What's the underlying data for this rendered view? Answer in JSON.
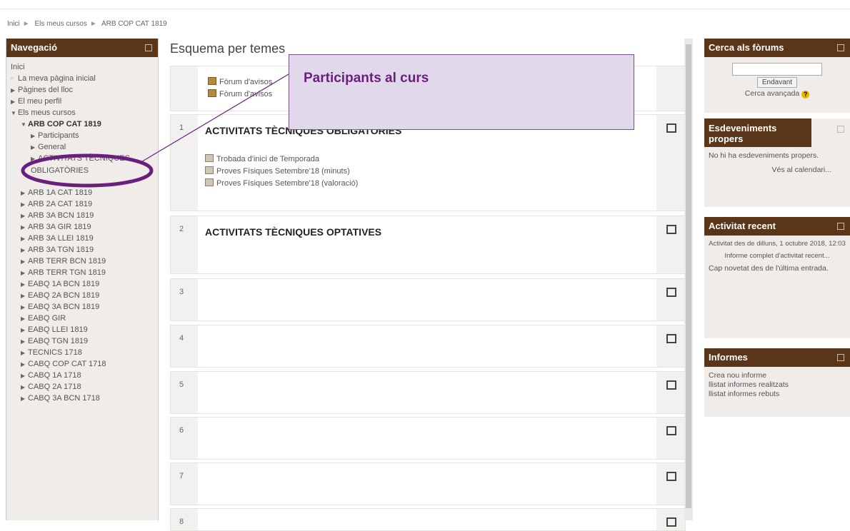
{
  "breadcrumb": [
    "Inici",
    "Els meus cursos",
    "ARB COP CAT 1819"
  ],
  "nav": {
    "title": "Navegació",
    "items": [
      {
        "label": "Inici"
      },
      {
        "label": "La meva pàgina inicial"
      },
      {
        "label": "Pàgines del lloc"
      },
      {
        "label": "El meu perfil"
      },
      {
        "label": "Els meus cursos"
      },
      {
        "label": "ARB COP CAT 1819"
      },
      {
        "label": "Participants"
      },
      {
        "label": "General"
      },
      {
        "label": "ACTIVITATS TÈCNIQUES OBLIGATÒRIES"
      },
      {
        "label": "ARB 1A CAT 1819"
      },
      {
        "label": "ARB 2A CAT 1819"
      },
      {
        "label": "ARB 3A BCN 1819"
      },
      {
        "label": "ARB 3A GIR 1819"
      },
      {
        "label": "ARB 3A LLEI 1819"
      },
      {
        "label": "ARB 3A TGN 1819"
      },
      {
        "label": "ARB TERR BCN 1819"
      },
      {
        "label": "ARB TERR TGN 1819"
      },
      {
        "label": "EABQ 1A BCN 1819"
      },
      {
        "label": "EABQ 2A BCN 1819"
      },
      {
        "label": "EABQ 3A BCN 1819"
      },
      {
        "label": "EABQ GIR"
      },
      {
        "label": "EABQ LLEI 1819"
      },
      {
        "label": "EABQ TGN 1819"
      },
      {
        "label": "TECNICS 1718"
      },
      {
        "label": "CABQ COP CAT 1718"
      },
      {
        "label": "CABQ 1A 1718"
      },
      {
        "label": "CABQ 2A 1718"
      },
      {
        "label": "CABQ 3A BCN 1718"
      }
    ]
  },
  "main": {
    "title": "Esquema per temes",
    "section0": {
      "activities": [
        "Fòrum d'avisos",
        "Fòrum d'avisos"
      ]
    },
    "sections": [
      {
        "num": "1",
        "title": "ACTIVITATS TÈCNIQUES OBLIGATÒRIES",
        "activities": [
          "Trobada d'inici de Temporada",
          "Proves Físiques Setembre'18 (minuts)",
          "Proves Físiques Setembre'18 (valoració)"
        ]
      },
      {
        "num": "2",
        "title": "ACTIVITATS TÈCNIQUES OPTATIVES"
      },
      {
        "num": "3"
      },
      {
        "num": "4"
      },
      {
        "num": "5"
      },
      {
        "num": "6"
      },
      {
        "num": "7"
      },
      {
        "num": "8"
      }
    ]
  },
  "callout": {
    "text": "Participants al curs"
  },
  "blocks": {
    "forum_search": {
      "title": "Cerca als fòrums",
      "button": "Endavant",
      "advanced": "Cerca avançada"
    },
    "events": {
      "title": "Esdeveniments propers",
      "text": "No hi ha esdeveniments propers.",
      "link": "Vés al calendari..."
    },
    "recent": {
      "title": "Activitat recent",
      "since": "Activitat des de dilluns, 1 octubre 2018, 12:03",
      "report": "Informe complet d'activitat recent...",
      "none": "Cap novetat des de l'última entrada."
    },
    "reports": {
      "title": "Informes",
      "links": [
        "Crea nou informe",
        "llistat informes realitzats",
        "llistat informes rebuts"
      ]
    }
  }
}
